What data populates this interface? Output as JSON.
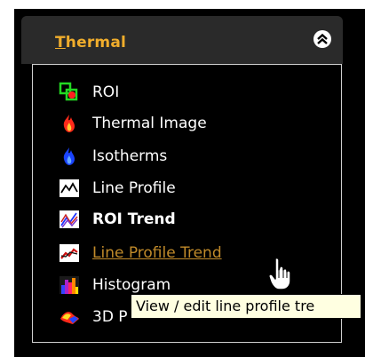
{
  "panel": {
    "title_prefix": "T",
    "title_rest": "hermal",
    "collapse_icon": "double-chevron-up-icon"
  },
  "items": [
    {
      "label": "ROI",
      "icon": "roi-icon"
    },
    {
      "label": "Thermal Image",
      "icon": "flame-icon"
    },
    {
      "label": "Isotherms",
      "icon": "blue-flame-icon"
    },
    {
      "label": "Line Profile",
      "icon": "line-profile-icon"
    },
    {
      "label": "ROI Trend",
      "icon": "roi-trend-icon"
    },
    {
      "label": "Line Profile Trend",
      "icon": "line-profile-trend-icon"
    },
    {
      "label": "Histogram",
      "icon": "histogram-icon"
    },
    {
      "label": "3D P",
      "icon": "3d-plot-icon"
    }
  ],
  "tooltip": {
    "text": "View / edit line profile tre"
  },
  "colors": {
    "accent": "#f0ad2c",
    "link": "#c08a2a",
    "panel_bg": "#000000",
    "header_bg": "#2a2a2a",
    "tooltip_bg": "#ffffe1"
  }
}
